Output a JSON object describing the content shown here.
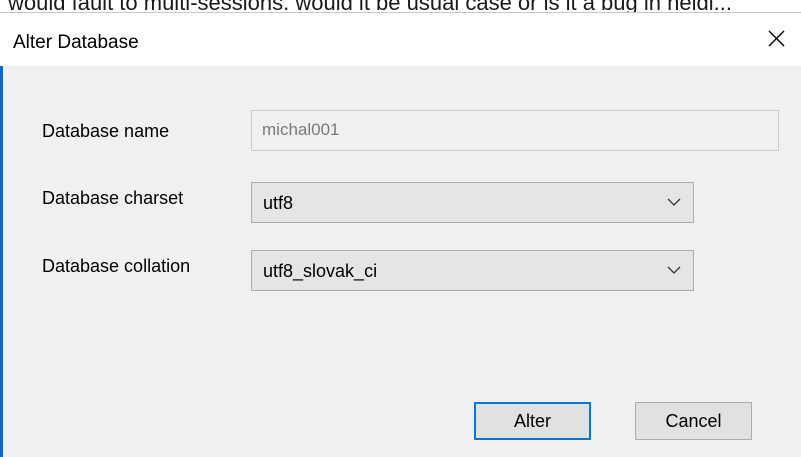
{
  "background_window": {
    "partial_text": "would fault to multi-sessions. would it be usual case or is it a bug in heidi..."
  },
  "dialog": {
    "title": "Alter Database",
    "close_icon": "close-icon",
    "accent_color": "#0078d7"
  },
  "form": {
    "name_label": "Database name",
    "name_value": "michal001",
    "charset_label": "Database charset",
    "charset_value": "utf8",
    "collation_label": "Database collation",
    "collation_value": "utf8_slovak_ci"
  },
  "buttons": {
    "alter_label": "Alter",
    "cancel_label": "Cancel"
  }
}
